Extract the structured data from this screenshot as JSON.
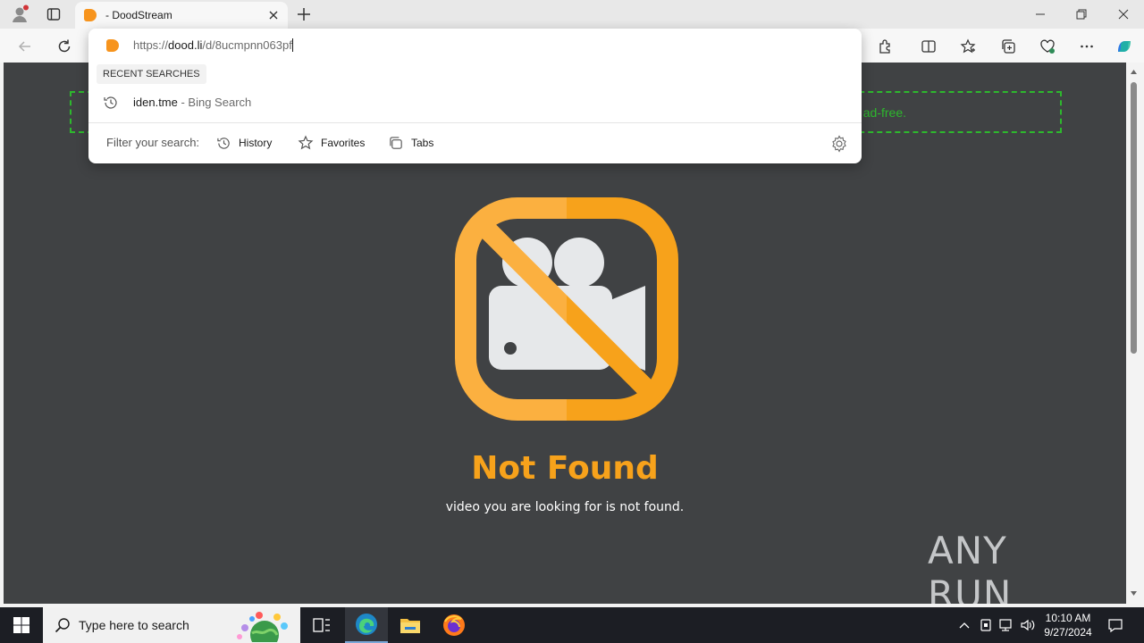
{
  "browser": {
    "tab": {
      "title": "- DoodStream"
    },
    "address": {
      "scheme": "https://",
      "domain": "dood.li",
      "path": "/d/8ucmpnn063pf"
    },
    "colors": {
      "favicon": "#f7941d"
    }
  },
  "omnibox": {
    "recent_header": "RECENT SEARCHES",
    "suggestion": {
      "query": "iden.tme",
      "source": " - Bing Search"
    },
    "filter_label": "Filter your search:",
    "filters": [
      "History",
      "Favorites",
      "Tabs"
    ]
  },
  "page": {
    "ad_text": "ad-free.",
    "title": "Not Found",
    "subtitle": "video you are looking for is not found.",
    "watermark": "ANY RUN",
    "colors": {
      "background": "#404244",
      "accent": "#f7a21b",
      "ad_border": "#2db82d"
    }
  },
  "taskbar": {
    "search_placeholder": "Type here to search",
    "time": "10:10 AM",
    "date": "9/27/2024"
  }
}
